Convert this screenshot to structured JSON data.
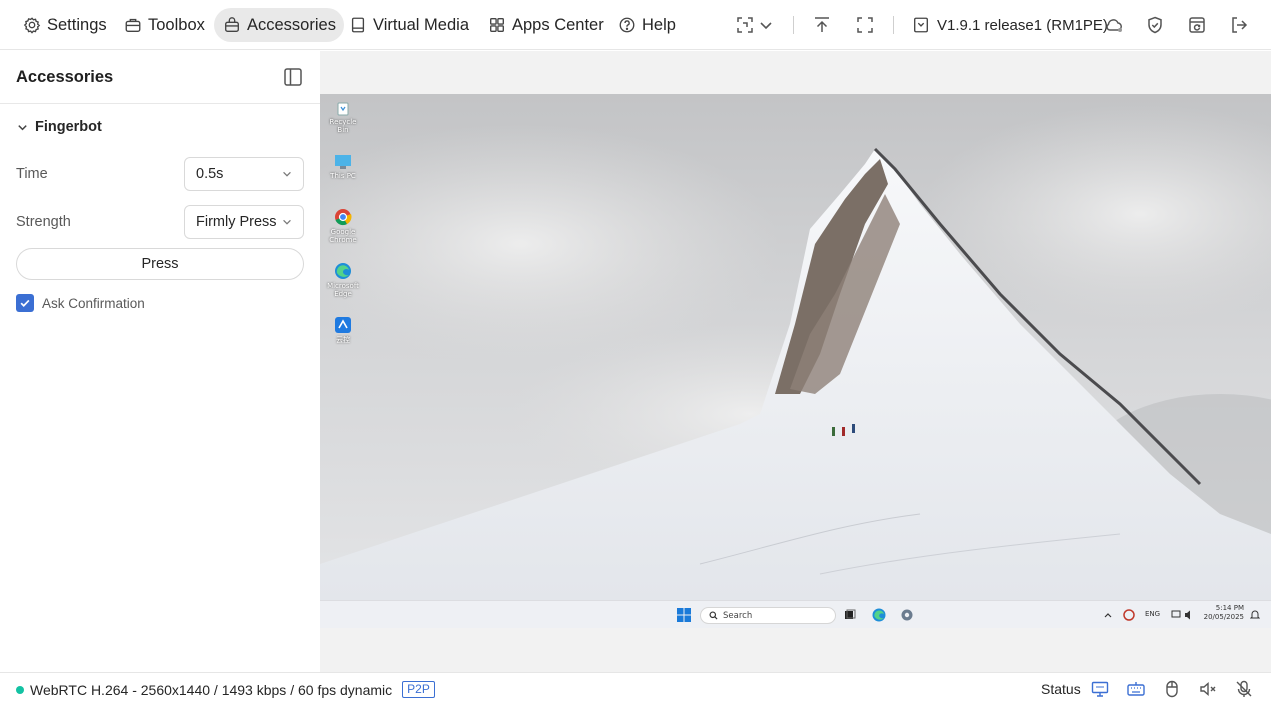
{
  "topbar": {
    "nav": [
      {
        "label": "Settings",
        "icon": "gear-icon"
      },
      {
        "label": "Toolbox",
        "icon": "toolbox-icon"
      },
      {
        "label": "Accessories",
        "icon": "bag-icon",
        "active": true
      },
      {
        "label": "Virtual Media",
        "icon": "media-icon"
      },
      {
        "label": "Apps Center",
        "icon": "apps-icon"
      },
      {
        "label": "Help",
        "icon": "help-icon"
      }
    ],
    "version": "V1.9.1 release1 (RM1PE)"
  },
  "sidebar": {
    "title": "Accessories",
    "section": "Fingerbot",
    "time_label": "Time",
    "time_value": "0.5s",
    "strength_label": "Strength",
    "strength_value": "Firmly Press",
    "press_label": "Press",
    "confirm_label": "Ask Confirmation",
    "confirm_checked": true
  },
  "remote": {
    "desktop_icons": [
      {
        "label": "Recycle Bin"
      },
      {
        "label": "This PC"
      },
      {
        "label": "Google Chrome"
      },
      {
        "label": "Microsoft Edge"
      },
      {
        "label": "云控"
      }
    ],
    "taskbar": {
      "search_placeholder": "Search",
      "lang": "ENG",
      "time": "5:14 PM",
      "date": "20/05/2025"
    }
  },
  "statusbar": {
    "connection": "WebRTC H.264 - 2560x1440 / 1493 kbps / 60 fps dynamic",
    "mode_badge": "P2P",
    "status_label": "Status"
  },
  "colors": {
    "accent": "#3b6fd3",
    "connected": "#13c2a3",
    "active_nav_bg": "#e9e9e9"
  }
}
